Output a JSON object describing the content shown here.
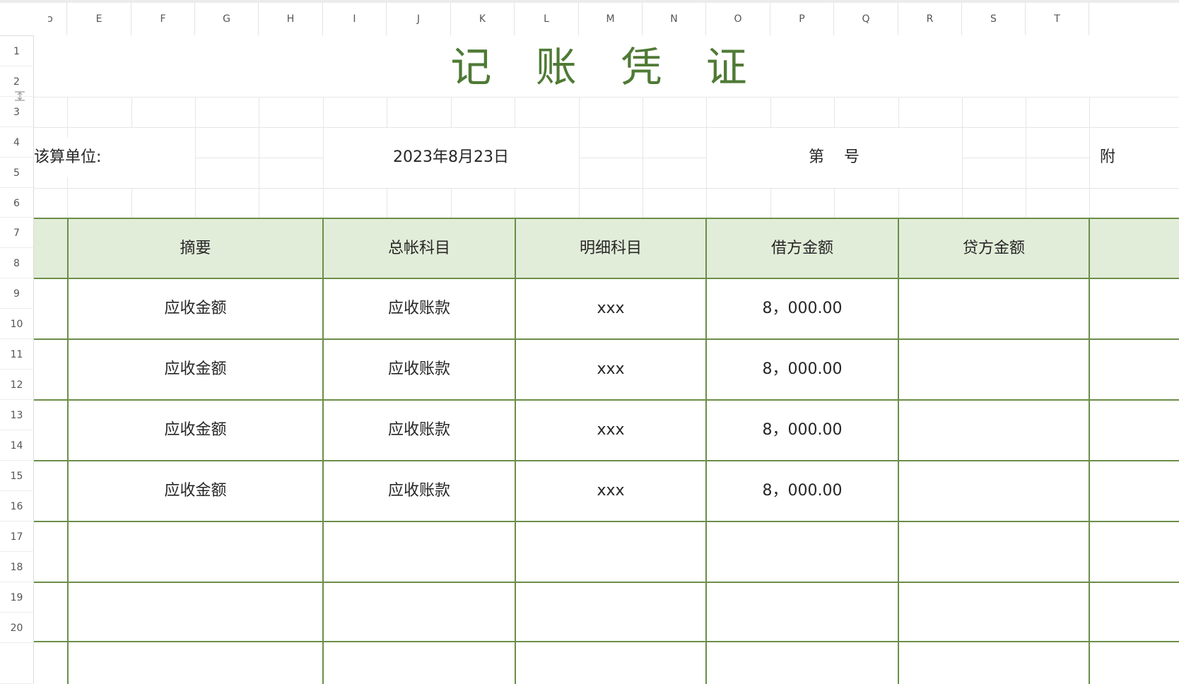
{
  "app": {
    "visibility_icon": "eye-icon"
  },
  "column_headers": [
    "D",
    "E",
    "F",
    "G",
    "H",
    "I",
    "J",
    "K",
    "L",
    "M",
    "N",
    "O",
    "P",
    "Q",
    "R",
    "S",
    "T"
  ],
  "column_headers_display": [
    "ↄ",
    "E",
    "F",
    "G",
    "H",
    "I",
    "J",
    "K",
    "L",
    "M",
    "N",
    "O",
    "P",
    "Q",
    "R",
    "S",
    "T"
  ],
  "row_headers": [
    "1",
    "2",
    "3",
    "4",
    "5",
    "6",
    "7",
    "8",
    "9",
    "10",
    "11",
    "12",
    "13",
    "14",
    "15",
    "16",
    "17",
    "18",
    "19",
    "20"
  ],
  "document": {
    "title": "记 账 凭 证",
    "unit_label": "核算单位：",
    "unit_label_visible": "该算单位:",
    "date": "2023年8月23日",
    "number_label": "第    号",
    "right_cut_text": "附"
  },
  "table": {
    "headers": [
      "摘要",
      "总帐科目",
      "明细科目",
      "借方金额",
      "贷方金额"
    ],
    "rows": [
      [
        "应收金额",
        "应收账款",
        "xxx",
        "8，000.00",
        ""
      ],
      [
        "应收金额",
        "应收账款",
        "xxx",
        "8，000.00",
        ""
      ],
      [
        "应收金额",
        "应收账款",
        "xxx",
        "8，000.00",
        ""
      ],
      [
        "应收金额",
        "应收账款",
        "xxx",
        "8，000.00",
        ""
      ],
      [
        "",
        "",
        "",
        "",
        ""
      ],
      [
        "",
        "",
        "",
        "",
        ""
      ]
    ]
  },
  "colors": {
    "title_green": "#4f7a35",
    "header_fill": "#e2edd9",
    "table_line": "#6b8e48",
    "grid": "#e6e6e6"
  }
}
